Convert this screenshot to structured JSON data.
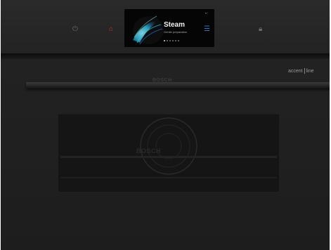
{
  "control_panel": {
    "icons": {
      "power": "power-icon",
      "home": "home-icon",
      "menu": "menu-icon",
      "lock": "lock-icon"
    },
    "accent_colors": {
      "home_icon": "#c43a2a",
      "menu_icon": "#2f74c0"
    }
  },
  "display": {
    "title": "Steam",
    "subtitle": "Gentle preparation",
    "status": "▾ ⁝",
    "page_dots": 6,
    "active_dot": 0,
    "wave_colors": [
      "#1e6fe0",
      "#31c9e8",
      "#8fe6f5"
    ]
  },
  "door": {
    "brand": "BOSCH",
    "series_left": "accent",
    "series_right": "line",
    "interior_text": "BOSCH"
  }
}
